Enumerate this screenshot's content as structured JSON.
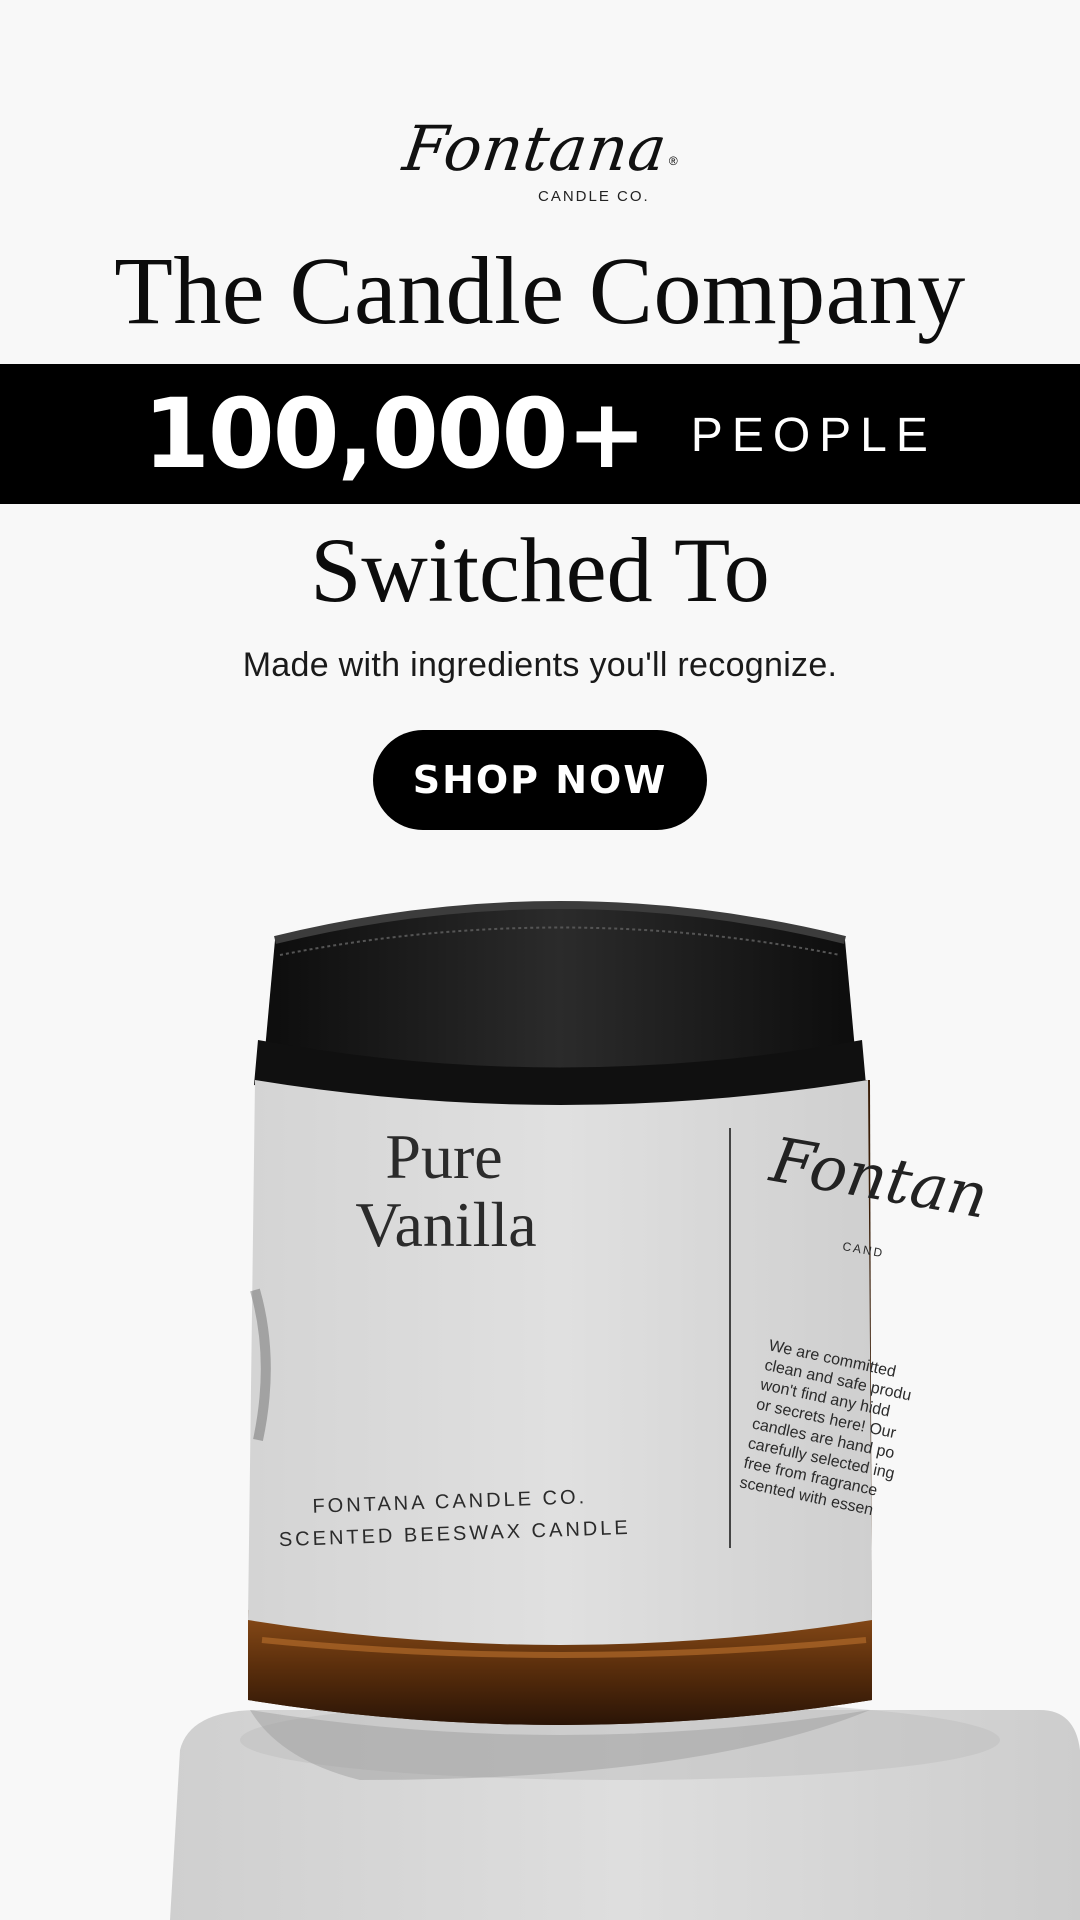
{
  "brand": {
    "logo_script": "Fontana",
    "logo_registered": "®",
    "logo_subtitle": "CANDLE CO."
  },
  "hero": {
    "headline": "The Candle Company",
    "band_number": "100,000+",
    "band_word": "PEOPLE",
    "subheadline": "Switched To",
    "tagline": "Made with ingredients you'll recognize.",
    "cta_label": "SHOP NOW"
  },
  "product_label": {
    "name_line1": "Pure",
    "name_line2": "Vanilla",
    "maker_line": "FONTANA CANDLE CO.",
    "type_line": "SCENTED BEESWAX CANDLE",
    "side_brand": "Fontan",
    "side_sub": "CAND",
    "side_copy": [
      "We are committed",
      "clean and safe produ",
      "won't find any hidd",
      "or secrets here! Our",
      "candles are hand po",
      "carefully selected ing",
      "free from fragrance",
      "scented with essen"
    ]
  },
  "colors": {
    "background": "#f8f8f8",
    "band": "#000000",
    "cta": "#000000",
    "jar_amber": "#6b3a12",
    "lid": "#161616",
    "label": "#dcdcdc"
  }
}
